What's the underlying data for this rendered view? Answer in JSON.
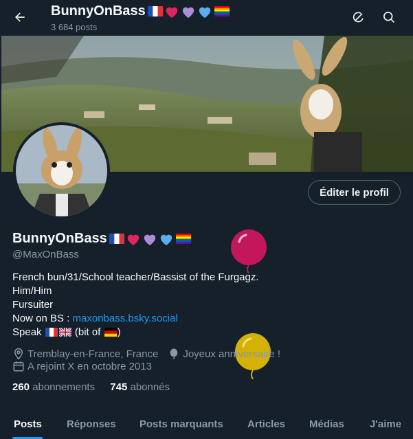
{
  "header": {
    "title": "BunnyOnBass",
    "post_count": "3 684 posts"
  },
  "profile": {
    "display_name": "BunnyOnBass",
    "handle": "@MaxOnBass",
    "edit_button": "Éditer le profil",
    "bio": {
      "line1": "French bun/31/School teacher/Bassist of the Furgagz.",
      "line2": "Him/Him",
      "line3": "Fursuiter",
      "line4_prefix": "Now on BS : ",
      "line4_link": "maxonbass.bsky.social",
      "line5_prefix": "Speak ",
      "line5_middle": " (bit of ",
      "line5_suffix": ")"
    },
    "location": "Tremblay-en-France, France",
    "birthday": "Joyeux anniversaire !",
    "joined": "A rejoint X en octobre 2013",
    "following_count": "260",
    "following_label": "abonnements",
    "followers_count": "745",
    "followers_label": "abonnés"
  },
  "tabs": [
    {
      "label": "Posts",
      "active": true
    },
    {
      "label": "Réponses",
      "active": false
    },
    {
      "label": "Posts marquants",
      "active": false
    },
    {
      "label": "Articles",
      "active": false
    },
    {
      "label": "Médias",
      "active": false
    },
    {
      "label": "J'aime",
      "active": false
    }
  ],
  "icons": {
    "back": "arrow-left-icon",
    "grok": "grok-icon",
    "search": "search-icon",
    "location": "location-pin-icon",
    "birthday": "balloon-icon",
    "calendar": "calendar-icon"
  },
  "colors": {
    "background": "#15202b",
    "accent": "#1d9bf0",
    "secondary_text": "#8b98a5",
    "balloon_pink": "#c2185b",
    "balloon_yellow": "#d4b106"
  }
}
